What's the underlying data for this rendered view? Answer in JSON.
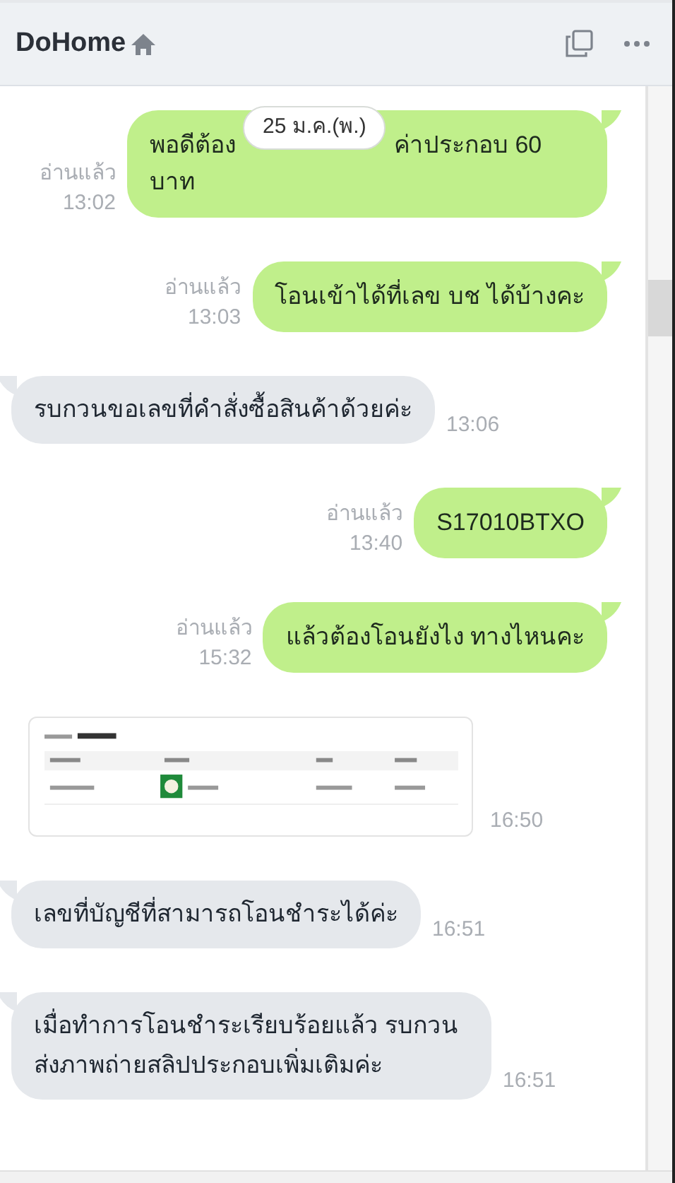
{
  "header": {
    "title": "DoHome"
  },
  "date_badge": "25 ม.ค.(พ.)",
  "messages": [
    {
      "kind": "sent",
      "parts": [
        "พอดีต้อง",
        "ค่าประกอบ 60",
        "บาท"
      ],
      "read": "อ่านแล้ว",
      "time": "13:02"
    },
    {
      "kind": "sent",
      "text": "โอนเข้าได้ที่เลข บช ได้บ้างคะ",
      "read": "อ่านแล้ว",
      "time": "13:03"
    },
    {
      "kind": "received",
      "text": "รบกวนขอเลขที่คำสั่งซื้อสินค้าด้วยค่ะ",
      "time": "13:06"
    },
    {
      "kind": "sent",
      "text": "S17010BTXO",
      "read": "อ่านแล้ว",
      "time": "13:40"
    },
    {
      "kind": "sent",
      "text": "แล้วต้องโอนยังไง ทางไหนคะ",
      "read": "อ่านแล้ว",
      "time": "15:32"
    },
    {
      "time": "16:50"
    },
    {
      "kind": "received",
      "text": "เลขที่บัญชีที่สามารถโอนชำระได้ค่ะ",
      "time": "16:51"
    },
    {
      "kind": "received",
      "text": "เมื่อทำการโอนชำระเรียบร้อยแล้ว รบกวนส่งภาพถ่ายสลิปประกอบเพิ่มเติมค่ะ",
      "time": "16:51"
    }
  ]
}
